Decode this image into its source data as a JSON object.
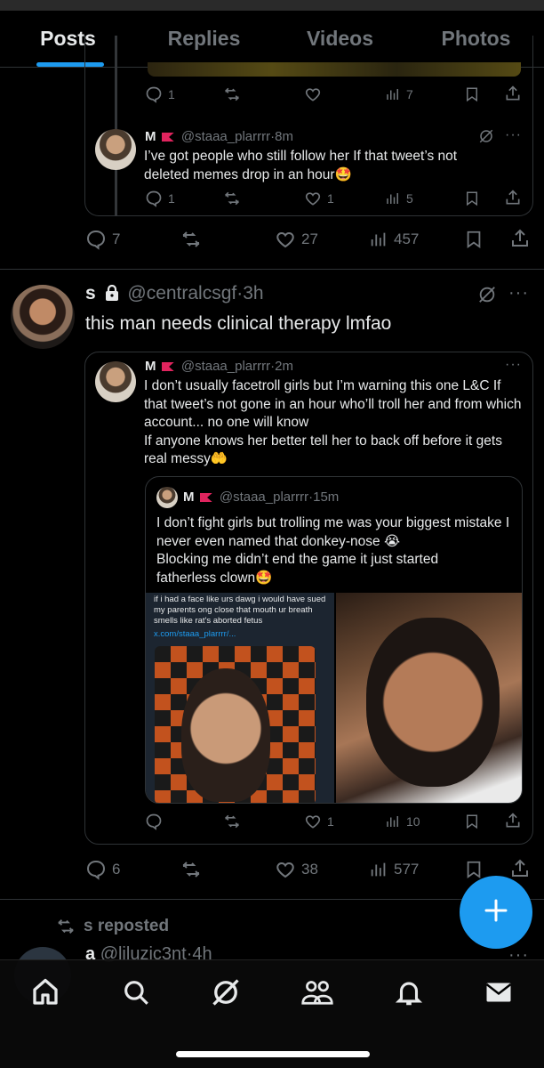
{
  "tabs": [
    {
      "label": "Posts"
    },
    {
      "label": "Replies"
    },
    {
      "label": "Videos"
    },
    {
      "label": "Photos"
    }
  ],
  "top_card": {
    "actions": {
      "replies": "1",
      "reposts": "",
      "likes": "",
      "views": "7"
    },
    "reply": {
      "name": "M",
      "handle": "@staaa_plarrrr",
      "time": "8m",
      "text": "I’ve got people who still follow her If that tweet’s not deleted memes drop in an hour🤩",
      "actions": {
        "replies": "1",
        "reposts": "",
        "likes": "1",
        "views": "5"
      }
    }
  },
  "post1_actions": {
    "replies": "7",
    "reposts": "",
    "likes": "27",
    "views": "457"
  },
  "post2": {
    "name": "s",
    "handle": "@centralcsgf",
    "time": "3h",
    "text": "this man needs clinical therapy lmfao",
    "quote": {
      "name": "M",
      "handle": "@staaa_plarrrr",
      "time": "2m",
      "text": "I don’t usually facetroll girls but I’m warning this one L&C If that tweet’s not gone in an hour who’ll troll her and from which account... no one will know\n If anyone knows her better tell her to back off before it gets real messy🤲",
      "nested": {
        "name": "M",
        "handle": "@staaa_plarrrr",
        "time": "15m",
        "text": "I don’t fight girls but trolling me was your biggest mistake I never even named that donkey-nose 😭\nBlocking me didn’t end the game  it just started\nfatherless clown🤩",
        "image_caption": "if i had a face like urs dawg i would have sued my parents ong close that mouth ur breath smells like rat's aborted fetus",
        "image_link": "x.com/staaa_plarrrr/..."
      },
      "actions": {
        "replies": "",
        "reposts": "",
        "likes": "1",
        "views": "10"
      }
    },
    "actions": {
      "replies": "6",
      "reposts": "",
      "likes": "38",
      "views": "577"
    }
  },
  "repost": {
    "label": "s reposted",
    "name": "a",
    "handle": "@liluzic3nt",
    "time": "4h"
  },
  "colors": {
    "accent": "#1d9bf0",
    "muted": "#71767b",
    "border": "#2f3336"
  }
}
